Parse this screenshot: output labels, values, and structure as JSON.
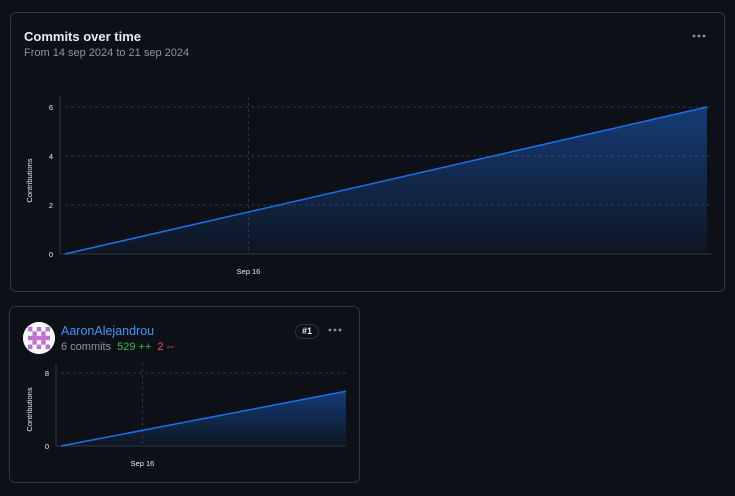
{
  "main": {
    "title": "Commits over time",
    "subtitle": "From 14 sep 2024 to 21 sep 2024",
    "menu_icon": "kebab-horizontal-icon"
  },
  "contributor": {
    "username": "AaronAlejandrou",
    "commits": "6 commits",
    "additions": "529 ++",
    "deletions": "2 --",
    "rank": "#1",
    "avatar_icon": "identicon-avatar",
    "menu_icon": "kebab-horizontal-icon"
  },
  "colors": {
    "background": "#0d1117",
    "border": "#30363d",
    "line": "#1f6feb",
    "link": "#4493f8",
    "additions": "#3fb950",
    "deletions": "#f85149",
    "avatar": "#c06fd1"
  },
  "chart_data": [
    {
      "type": "area",
      "ylabel": "Contributions",
      "x": [
        "2024-09-14",
        "2024-09-21"
      ],
      "values": [
        0,
        6
      ],
      "x_ticks": [
        {
          "x": "2024-09-16",
          "label": "Sep 16"
        }
      ],
      "y_ticks": [
        "0",
        "2",
        "4",
        "6"
      ],
      "ylim": [
        0,
        6
      ],
      "grid": true
    },
    {
      "type": "area",
      "ylabel": "Contributions",
      "x": [
        "2024-09-14",
        "2024-09-21"
      ],
      "values": [
        0,
        6
      ],
      "x_ticks": [
        {
          "x": "2024-09-16",
          "label": "Sep 16"
        }
      ],
      "y_ticks": [
        "0",
        "8"
      ],
      "ylim": [
        0,
        8
      ],
      "grid": true
    }
  ]
}
